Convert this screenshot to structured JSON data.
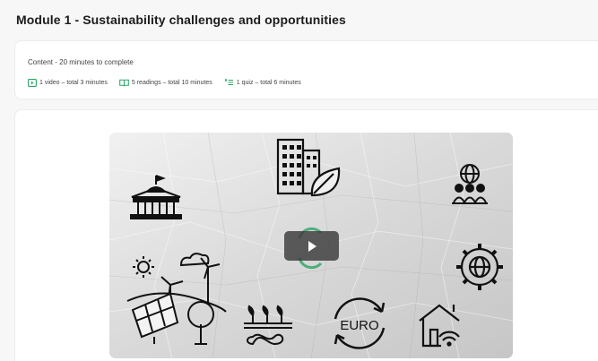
{
  "module": {
    "title": "Module 1 - Sustainability challenges and opportunities"
  },
  "content": {
    "summary": "Content - 20 minutes to complete",
    "items": [
      {
        "icon": "video-icon",
        "label": "1 video – total 3 minutes"
      },
      {
        "icon": "reading-icon",
        "label": "5 readings – total 10 minutes"
      },
      {
        "icon": "quiz-icon",
        "label": "1 quiz – total 6 minutes"
      }
    ]
  },
  "video": {
    "thumbnail_text": "EURO",
    "play_icon": "play-icon"
  },
  "colors": {
    "accent": "#2aa565",
    "card_bg": "#ffffff",
    "page_bg": "#f7f7f8"
  }
}
